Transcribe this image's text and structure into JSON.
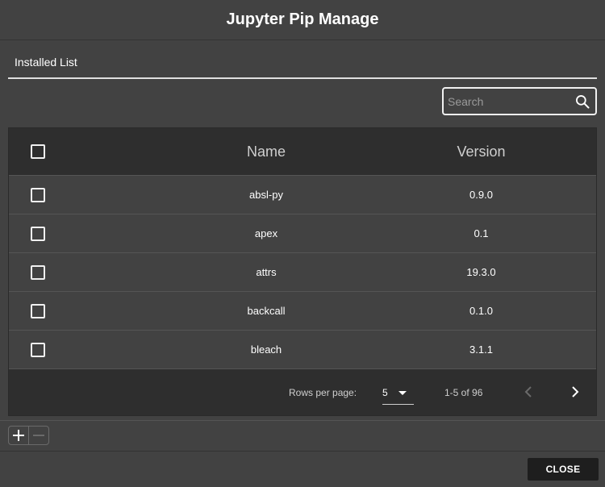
{
  "dialog": {
    "title": "Jupyter Pip Manage",
    "tab_label": "Installed List"
  },
  "search": {
    "placeholder": "Search",
    "value": "",
    "icon": "search-icon"
  },
  "table": {
    "columns": [
      "Name",
      "Version"
    ],
    "rows": [
      {
        "name": "absl-py",
        "version": "0.9.0",
        "checked": false
      },
      {
        "name": "apex",
        "version": "0.1",
        "checked": false
      },
      {
        "name": "attrs",
        "version": "19.3.0",
        "checked": false
      },
      {
        "name": "backcall",
        "version": "0.1.0",
        "checked": false
      },
      {
        "name": "bleach",
        "version": "3.1.1",
        "checked": false
      }
    ]
  },
  "pagination": {
    "rows_per_page_label": "Rows per page:",
    "rows_per_page": "5",
    "range": "1-5 of 96"
  },
  "footer": {
    "close_label": "CLOSE"
  },
  "colors": {
    "background": "#424242",
    "header_bg": "#2e2e2e",
    "close_button_bg": "#1e1e1e"
  }
}
